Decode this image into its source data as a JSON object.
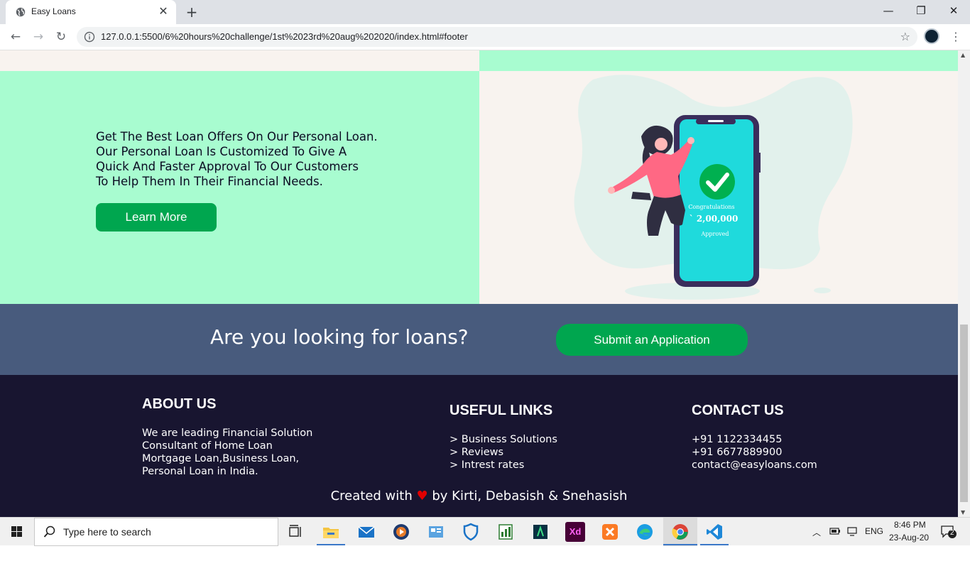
{
  "browser": {
    "tab_title": "Easy Loans",
    "tab_close": "✕",
    "new_tab": "+",
    "url": "127.0.0.1:5500/6%20hours%20challenge/1st%2023rd%20aug%202020/index.html#footer",
    "window_controls": [
      "—",
      "❐",
      "✕"
    ],
    "nav": {
      "back": "←",
      "forward": "→",
      "reload": "↻"
    },
    "star": "☆",
    "menu": "⋮"
  },
  "hero": {
    "lines": [
      "Get The Best Loan Offers On Our Personal Loan.",
      "Our Personal Loan Is Customized To Give A",
      "Quick And Faster Approval To Our Customers",
      "To Help Them In Their Financial Needs."
    ],
    "button": "Learn More",
    "phone": {
      "title": "Congratulations",
      "amount": "` 2,00,000",
      "status": "Approved"
    }
  },
  "cta": {
    "title": "Are you looking for loans?",
    "button": "Submit an Application"
  },
  "footer": {
    "about": {
      "heading": "ABOUT US",
      "lines": [
        "We are leading Financial Solution",
        "Consultant of Home Loan",
        "Mortgage Loan,Business Loan,",
        "Personal Loan in India."
      ]
    },
    "links": {
      "heading": "USEFUL LINKS",
      "items": [
        "> Business Solutions",
        "> Reviews",
        "> Intrest rates"
      ]
    },
    "contact": {
      "heading": "CONTACT US",
      "lines": [
        "+91 1122334455",
        "+91 6677889900",
        "contact@easyloans.com"
      ]
    },
    "credits": {
      "prefix": "Created with",
      "heart": "♥",
      "suffix": "by Kirti, Debasish & Snehasish"
    }
  },
  "taskbar": {
    "search_placeholder": "Type here to search",
    "apps": [
      {
        "icon": "task-view-icon"
      },
      {
        "icon": "file-explorer-icon"
      },
      {
        "icon": "mail-icon"
      },
      {
        "icon": "media-player-icon"
      },
      {
        "icon": "control-panel-icon"
      },
      {
        "icon": "security-icon"
      },
      {
        "icon": "spreadsheet-icon"
      },
      {
        "icon": "android-studio-icon"
      },
      {
        "icon": "adobe-xd-icon",
        "label": "Xd"
      },
      {
        "icon": "xampp-icon"
      },
      {
        "icon": "edge-icon"
      },
      {
        "icon": "chrome-icon"
      },
      {
        "icon": "vscode-icon"
      }
    ],
    "language": "ENG",
    "time": "8:46 PM",
    "date": "23-Aug-20",
    "notifications": "2"
  },
  "colors": {
    "mint": "#a8fcd0",
    "cream": "#f8f3ef",
    "green_button": "#00a64f",
    "cta_bg": "#485b7d",
    "footer_bg": "#181530",
    "phone_screen": "#1fdadc",
    "phone_frame": "#3a2e5c"
  }
}
